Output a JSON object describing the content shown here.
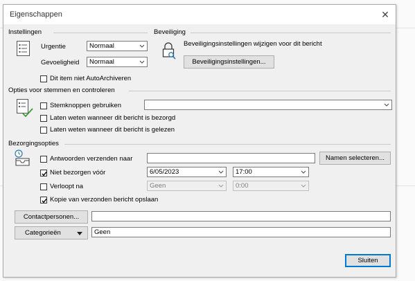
{
  "dialog": {
    "title": "Eigenschappen"
  },
  "settings": {
    "heading": "Instellingen",
    "urgency_label": "Urgentie",
    "urgency_value": "Normaal",
    "sensitivity_label": "Gevoeligheid",
    "sensitivity_value": "Normaal",
    "autoarchive_label": "Dit item niet AutoArchiveren",
    "autoarchive_checked": false
  },
  "security": {
    "heading": "Beveiliging",
    "text": "Beveiligingsinstellingen wijzigen voor dit bericht",
    "button": "Beveiligingsinstellingen..."
  },
  "voting": {
    "heading": "Opties voor stemmen en controleren",
    "use_buttons_label": "Stemknoppen gebruiken",
    "use_buttons_value": "",
    "delivered_label": "Laten weten wanneer dit bericht is bezorgd",
    "read_label": "Laten weten wanneer dit bericht is gelezen"
  },
  "delivery": {
    "heading": "Bezorgingsopties",
    "reply_to_label": "Antwoorden verzenden naar",
    "reply_to_value": "",
    "select_names_button": "Namen selecteren...",
    "not_before_label": "Niet bezorgen vóór",
    "not_before_checked": true,
    "not_before_date": "6/05/2023",
    "not_before_time": "17:00",
    "expires_label": "Verloopt na",
    "expires_checked": false,
    "expires_date": "Geen",
    "expires_time": "0:00",
    "save_copy_label": "Kopie van verzonden bericht opslaan",
    "save_copy_checked": true
  },
  "contacts": {
    "button": "Contactpersonen...",
    "value": ""
  },
  "categories": {
    "button": "Categorieën",
    "value": "Geen"
  },
  "footer": {
    "close_button": "Sluiten"
  }
}
